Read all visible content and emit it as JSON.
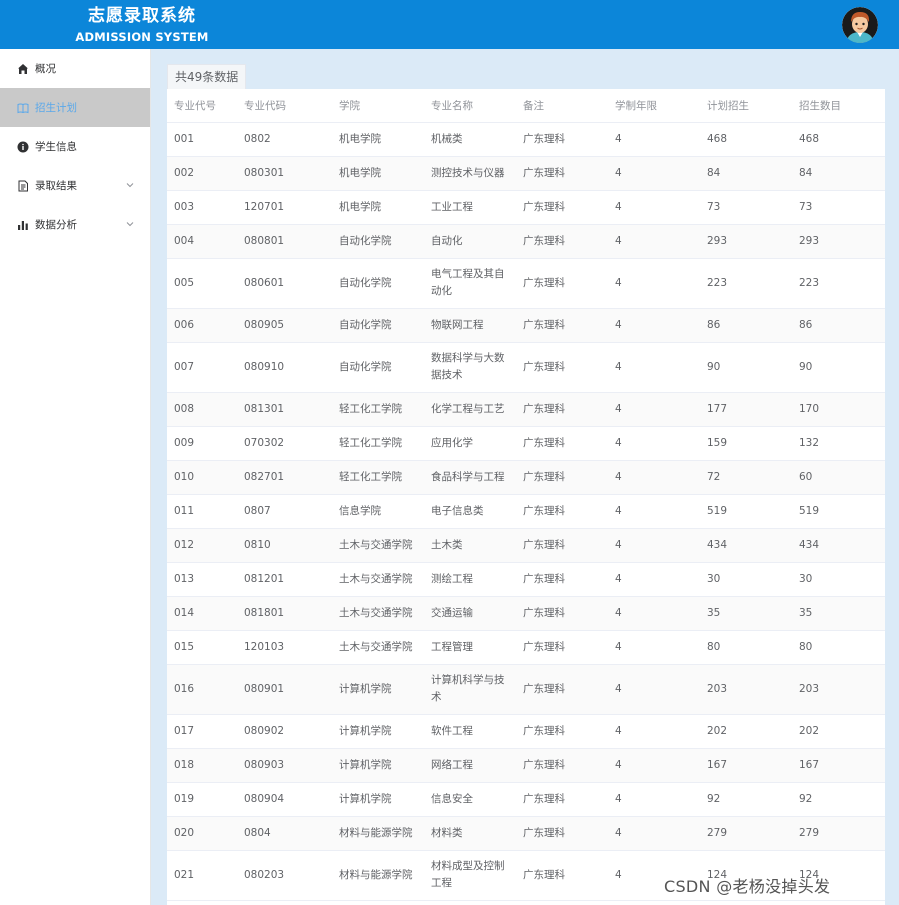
{
  "header": {
    "title_cn": "志愿录取系统",
    "title_en": "ADMISSION SYSTEM"
  },
  "sidebar": {
    "items": [
      {
        "label": "概况",
        "icon": "home-icon"
      },
      {
        "label": "招生计划",
        "icon": "book-icon",
        "active": true
      },
      {
        "label": "学生信息",
        "icon": "info-icon"
      },
      {
        "label": "录取结果",
        "icon": "document-icon",
        "expandable": true
      },
      {
        "label": "数据分析",
        "icon": "bar-chart-icon",
        "expandable": true
      }
    ]
  },
  "main": {
    "count_label": "共49条数据",
    "table": {
      "headers": [
        "专业代号",
        "专业代码",
        "学院",
        "专业名称",
        "备注",
        "学制年限",
        "计划招生",
        "招生数目"
      ],
      "rows": [
        [
          "001",
          "0802",
          "机电学院",
          "机械类",
          "广东理科",
          "4",
          "468",
          "468"
        ],
        [
          "002",
          "080301",
          "机电学院",
          "测控技术与仪器",
          "广东理科",
          "4",
          "84",
          "84"
        ],
        [
          "003",
          "120701",
          "机电学院",
          "工业工程",
          "广东理科",
          "4",
          "73",
          "73"
        ],
        [
          "004",
          "080801",
          "自动化学院",
          "自动化",
          "广东理科",
          "4",
          "293",
          "293"
        ],
        [
          "005",
          "080601",
          "自动化学院",
          "电气工程及其自动化",
          "广东理科",
          "4",
          "223",
          "223"
        ],
        [
          "006",
          "080905",
          "自动化学院",
          "物联网工程",
          "广东理科",
          "4",
          "86",
          "86"
        ],
        [
          "007",
          "080910",
          "自动化学院",
          "数据科学与大数据技术",
          "广东理科",
          "4",
          "90",
          "90"
        ],
        [
          "008",
          "081301",
          "轻工化工学院",
          "化学工程与工艺",
          "广东理科",
          "4",
          "177",
          "170"
        ],
        [
          "009",
          "070302",
          "轻工化工学院",
          "应用化学",
          "广东理科",
          "4",
          "159",
          "132"
        ],
        [
          "010",
          "082701",
          "轻工化工学院",
          "食品科学与工程",
          "广东理科",
          "4",
          "72",
          "60"
        ],
        [
          "011",
          "0807",
          "信息学院",
          "电子信息类",
          "广东理科",
          "4",
          "519",
          "519"
        ],
        [
          "012",
          "0810",
          "土木与交通学院",
          "土木类",
          "广东理科",
          "4",
          "434",
          "434"
        ],
        [
          "013",
          "081201",
          "土木与交通学院",
          "测绘工程",
          "广东理科",
          "4",
          "30",
          "30"
        ],
        [
          "014",
          "081801",
          "土木与交通学院",
          "交通运输",
          "广东理科",
          "4",
          "35",
          "35"
        ],
        [
          "015",
          "120103",
          "土木与交通学院",
          "工程管理",
          "广东理科",
          "4",
          "80",
          "80"
        ],
        [
          "016",
          "080901",
          "计算机学院",
          "计算机科学与技术",
          "广东理科",
          "4",
          "203",
          "203"
        ],
        [
          "017",
          "080902",
          "计算机学院",
          "软件工程",
          "广东理科",
          "4",
          "202",
          "202"
        ],
        [
          "018",
          "080903",
          "计算机学院",
          "网络工程",
          "广东理科",
          "4",
          "167",
          "167"
        ],
        [
          "019",
          "080904",
          "计算机学院",
          "信息安全",
          "广东理科",
          "4",
          "92",
          "92"
        ],
        [
          "020",
          "0804",
          "材料与能源学院",
          "材料类",
          "广东理科",
          "4",
          "279",
          "279"
        ],
        [
          "021",
          "080203",
          "材料与能源学院",
          "材料成型及控制工程",
          "广东理科",
          "4",
          "124",
          "124"
        ]
      ]
    }
  },
  "watermark": "CSDN @老杨没掉头发",
  "colors": {
    "header": "#0c86d9",
    "active_nav_bg": "#c9c9c9",
    "active_nav_text": "#5aa8ea",
    "page_bg": "#dbeaf7"
  }
}
